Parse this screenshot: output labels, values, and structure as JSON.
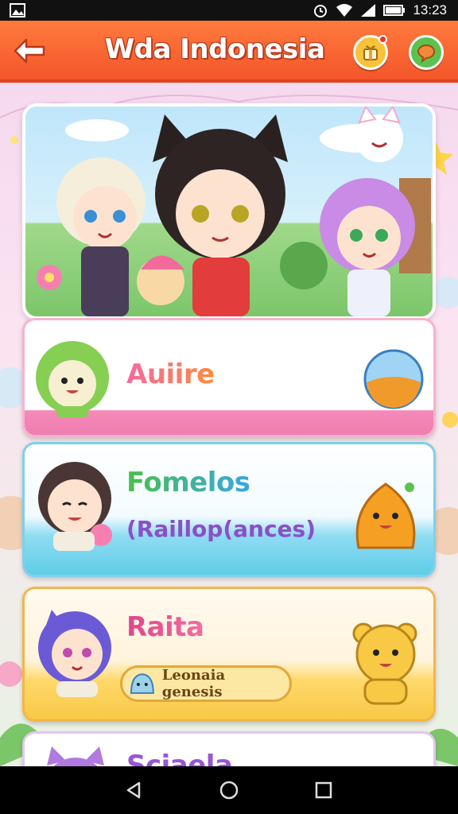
{
  "status_bar": {
    "time": "13:23",
    "icons": [
      "image-icon",
      "alarm-icon",
      "wifi-icon",
      "signal-icon",
      "battery-icon"
    ]
  },
  "app_bar": {
    "title": "Wda Indonesia",
    "back_icon": "back-arrow-icon",
    "actions": [
      "gift-icon",
      "chat-icon"
    ]
  },
  "cards": [
    {
      "title": "Auiire",
      "right_icon": "half-moon-orb-icon"
    },
    {
      "title": "Fomelos",
      "subtitle": "(Raillop(ances)",
      "right_icon": "orange-creature-icon"
    },
    {
      "title": "Raita",
      "button_label": "Leonaia genesis",
      "right_icon": "yellow-bear-icon"
    },
    {
      "title": "Sciaela"
    }
  ],
  "nav_bar": {
    "icons": [
      "back-triangle-icon",
      "home-circle-icon",
      "recents-square-icon"
    ]
  },
  "colors": {
    "app_bar": "#f4562a",
    "accent_green": "#5cc24e",
    "accent_yellow": "#f8c23a"
  }
}
